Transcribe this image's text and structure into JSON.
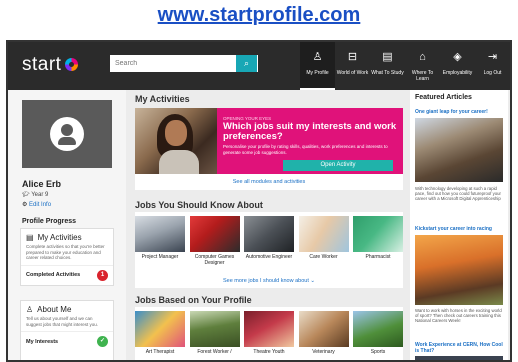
{
  "caption_url": "www.startprofile.com",
  "header": {
    "logo": "start",
    "search_placeholder": "Search",
    "search_button_icon": "search-icon",
    "nav": [
      {
        "label": "My Profile",
        "icon": "person-icon",
        "glyph": "♙"
      },
      {
        "label": "World of Work",
        "icon": "briefcase-icon",
        "glyph": "⊟"
      },
      {
        "label": "What To Study",
        "icon": "book-icon",
        "glyph": "▤"
      },
      {
        "label": "Where To Learn",
        "icon": "graduation-cap-icon",
        "glyph": "⌂"
      },
      {
        "label": "Employability",
        "icon": "layers-icon",
        "glyph": "◈"
      },
      {
        "label": "Log Out",
        "icon": "logout-icon",
        "glyph": "⇥"
      }
    ]
  },
  "profile": {
    "name": "Alice Erb",
    "year": "Year 9",
    "edit": "Edit Info",
    "progress_title": "Profile Progress",
    "activities_card": {
      "title": "My Activities",
      "text": "Complete activities so that you're better prepared to make your education and career related choices.",
      "footer": "Completed Activities",
      "count": "1"
    },
    "about_card": {
      "title": "About Me",
      "text": "Tell us about yourself and we can suggest jobs that might interest you.",
      "footer": "My Interests",
      "count": ""
    }
  },
  "activities": {
    "title": "My Activities",
    "kicker": "OPENING YOUR EYES",
    "hero_title": "Which jobs suit my interests and work preferences?",
    "hero_desc": "Personalise your profile by rating skills, qualities, work preferences and interests to generate some job suggestions.",
    "button": "Open Activity",
    "see_all": "See all modules and activities"
  },
  "jobs_know": {
    "title": "Jobs You Should Know About",
    "items": [
      {
        "label": "Project Manager"
      },
      {
        "label": "Computer Games Designer"
      },
      {
        "label": "Automotive Engineer"
      },
      {
        "label": "Care Worker"
      },
      {
        "label": "Pharmacist"
      }
    ],
    "see_more": "See more jobs I should know about ⌄"
  },
  "jobs_profile": {
    "title": "Jobs Based on Your Profile",
    "items": [
      {
        "label": "Art Therapist"
      },
      {
        "label": "Forest Worker /"
      },
      {
        "label": "Theatre Youth"
      },
      {
        "label": "Veterinary"
      },
      {
        "label": "Sports"
      }
    ]
  },
  "featured": {
    "title": "Featured Articles",
    "articles": [
      {
        "link": "One giant leap for your career!",
        "text": "With technology developing at such a rapid pace, find out how you could futureproof your career with a Microsoft Digital Apprenticeship"
      },
      {
        "link": "Kickstart your career into racing",
        "text": "Want to work with horses in the exciting world of sport? Then check out careers training this National Careers Week!"
      },
      {
        "link": "Work Experience at CERN, How Cool is That?",
        "text": ""
      }
    ]
  },
  "colors": {
    "accent": "#18a7b5",
    "hero": "#e0127a",
    "link": "#1a6fc4",
    "badge_red": "#d9232d",
    "badge_green": "#3fb34f"
  }
}
